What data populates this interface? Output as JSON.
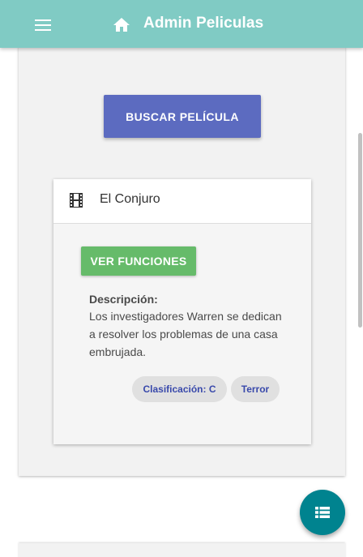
{
  "app_bar": {
    "title": "Admin Peliculas",
    "menu_icon": "menu-icon",
    "home_icon": "home-icon",
    "background_color": "#80cbc4"
  },
  "search": {
    "button_label": "BUSCAR PELÍCULA",
    "button_color": "#5c6bc0"
  },
  "movie_card": {
    "icon": "film-icon",
    "title": "El Conjuro",
    "functions_button_label": "VER FUNCIONES",
    "functions_button_color": "#66bb6a",
    "description_label": "Descripción:",
    "description_text": "Los investigadores Warren se dedican a resolver los problemas de una casa embrujada.",
    "chips": [
      {
        "label": "Clasificación: C"
      },
      {
        "label": "Terror"
      }
    ],
    "chip_text_color": "#3949ab"
  },
  "fab": {
    "icon": "list-icon",
    "color": "#00838f"
  }
}
